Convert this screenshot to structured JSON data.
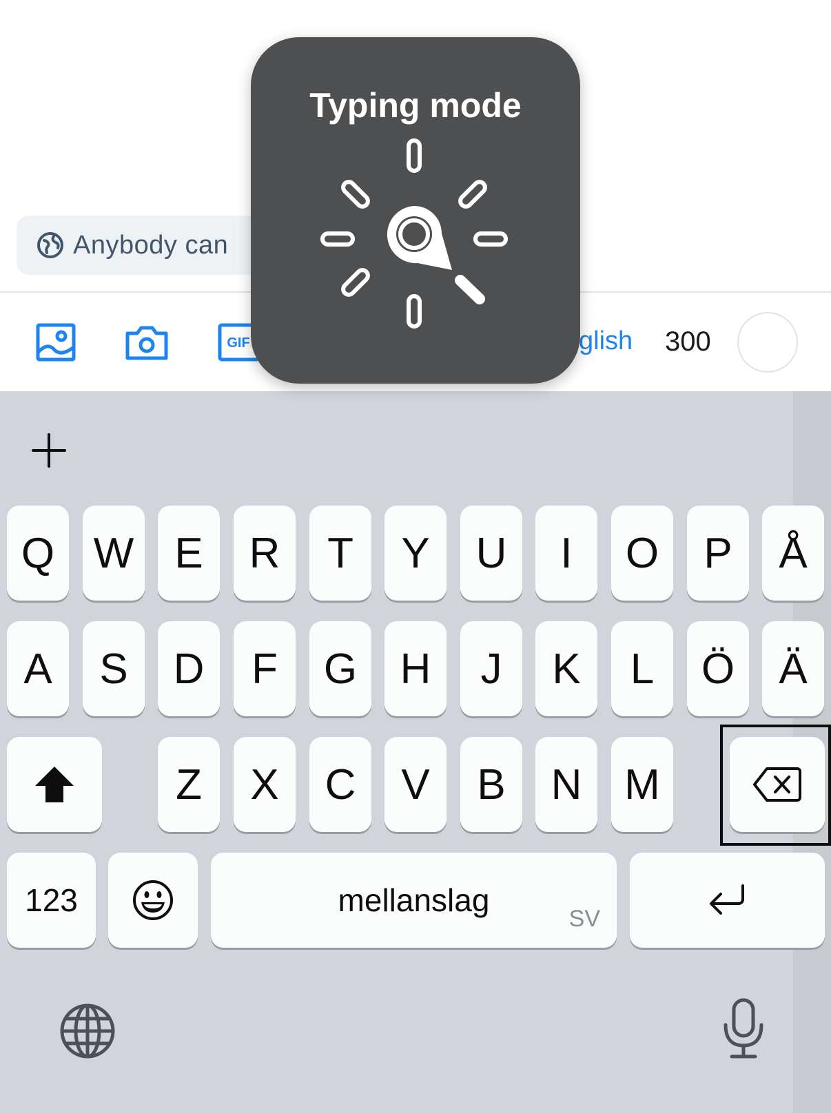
{
  "composer": {
    "audience_label": "Anybody can",
    "language_label": "glish",
    "char_count": "300"
  },
  "hud": {
    "title": "Typing mode"
  },
  "keyboard": {
    "row1": [
      "Q",
      "W",
      "E",
      "R",
      "T",
      "Y",
      "U",
      "I",
      "O",
      "P",
      "Å"
    ],
    "row2": [
      "A",
      "S",
      "D",
      "F",
      "G",
      "H",
      "J",
      "K",
      "L",
      "Ö",
      "Ä"
    ],
    "row3": [
      "Z",
      "X",
      "C",
      "V",
      "B",
      "N",
      "M"
    ],
    "numbers_label": "123",
    "space_label": "mellanslag",
    "space_lang": "SV"
  },
  "colors": {
    "accent": "#1d84f2",
    "keyboard_bg": "#d1d4db",
    "hud_bg": "#4d4f51"
  }
}
